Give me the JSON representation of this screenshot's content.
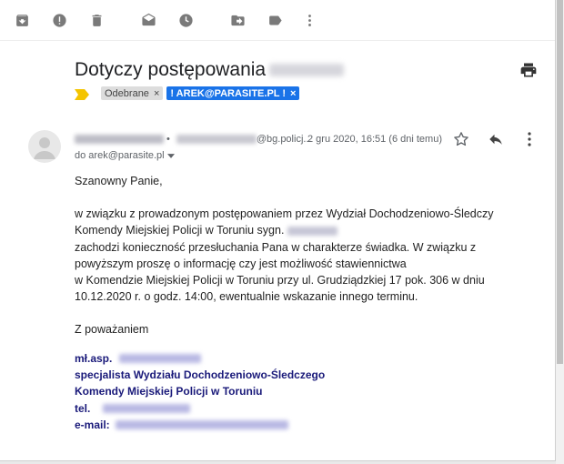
{
  "subject": "Dotyczy postępowania",
  "labels": [
    {
      "text": "Odebrane",
      "remove": "×"
    },
    {
      "text": "! AREK@PARASITE.PL !",
      "remove": "×"
    }
  ],
  "sender": {
    "domain": "@bg.policj...",
    "date": "2 gru 2020, 16:51 (6 dni temu)",
    "to": "do arek@parasite.pl"
  },
  "body": {
    "greeting": "Szanowny Panie,",
    "p1_line1": "w związku z prowadzonym postępowaniem przez Wydział Dochodzeniowo-Śledczy",
    "p1_line2": "Komendy Miejskiej Policji w Toruniu sygn.",
    "p1_line3": "zachodzi konieczność przesłuchania Pana w charakterze świadka. W związku z",
    "p1_line4": "powyższym proszę o informację czy jest możliwość stawiennictwa",
    "p1_line5": "w Komendzie Miejskiej Policji w Toruniu przy ul. Grudziądzkiej 17 pok. 306 w dniu",
    "p1_line6": "10.12.2020 r. o godz. 14:00, ewentualnie wskazanie innego terminu.",
    "closing": "Z poważaniem"
  },
  "signature": {
    "rank": "mł.asp.",
    "title1": "specjalista Wydziału Dochodzeniowo-Śledczego",
    "title2": "Komendy Miejskiej Policji w Toruniu",
    "tel_label": "tel.",
    "email_label": "e-mail:"
  },
  "colors": {
    "accent_blue": "#1a73e8",
    "signature_navy": "#1a1a7a",
    "important_marker": "#f4c400"
  },
  "icons": [
    "archive-icon",
    "report-spam-icon",
    "delete-icon",
    "mark-unread-icon",
    "snooze-icon",
    "move-to-icon",
    "label-icon",
    "more-vert-icon",
    "print-icon",
    "important-marker-icon",
    "avatar-icon",
    "star-icon",
    "reply-icon",
    "message-more-icon"
  ]
}
